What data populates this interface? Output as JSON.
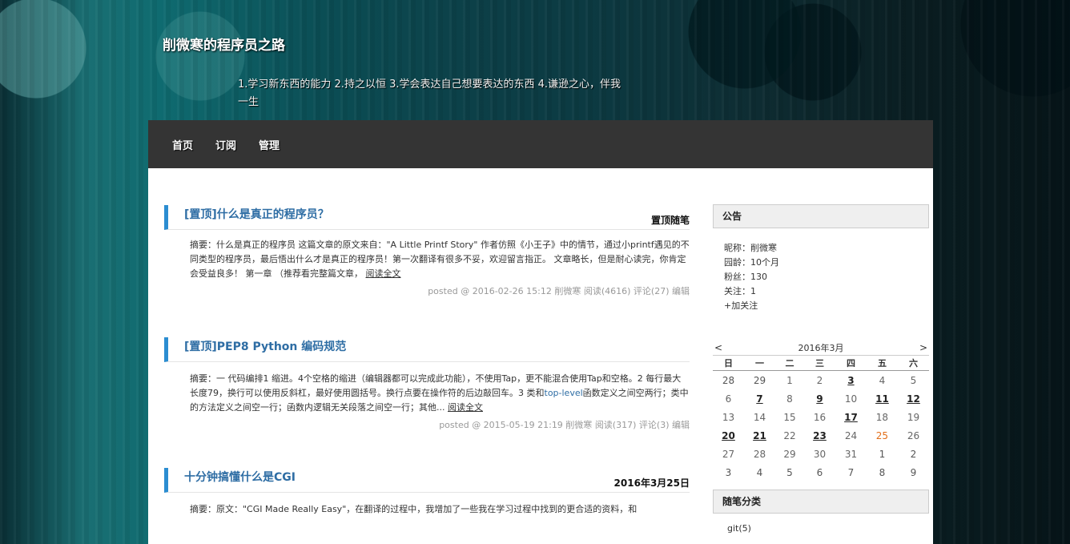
{
  "header": {
    "title": "削微寒的程序员之路",
    "description": "1.学习新东西的能力 2.持之以恒 3.学会表达自己想要表达的东西 4.谦逊之心，伴我一生"
  },
  "nav": {
    "items": [
      "首页",
      "订阅",
      "管理"
    ]
  },
  "posts": [
    {
      "title": "[置顶]什么是真正的程序员？",
      "date_label": "置顶随笔",
      "summary_a": "摘要：什么是真正的程序员 这篇文章的原文来自：\"A Little Printf Story\" 作者仿照《小王子》中的情节，通过小pri",
      "summary_b": "ntf遇见的不同类型的程序员，最后悟出什么才是真正的程序员！第一次翻译有很多不妥，欢迎留言指正。 文章略长，但是耐心读完，你肯定会受益良多！ 第一章 （推荐看完整篇文章， ",
      "read_more": "阅读全文",
      "footer_posted": "posted @ 2016-02-26 15:12 削微寒",
      "footer_reads": "阅读(4616)",
      "footer_comments": "评论(27)",
      "footer_edit": "编辑"
    },
    {
      "title": "[置顶]PEP8 Python 编码规范",
      "date_label": "",
      "summary_a": "摘要：一 代码编排1 缩进。4个空格的缩进（编辑器都可以完成此功能），不使用Tap，更不能混合使用Tap和空格。2 每行最大长度79，换行可以使用反斜杠，最好使用圆括号。换行点要在操作符的后边敲回车。3 类和",
      "summary_hl": "top-level",
      "summary_b": "函数定义之间空两行；类中的方法定义之间空一行；函数内逻辑无关段落之间空一行；其他... ",
      "read_more": "阅读全文",
      "footer_posted": "posted @ 2015-05-19 21:19 削微寒",
      "footer_reads": "阅读(317)",
      "footer_comments": "评论(3)",
      "footer_edit": "编辑"
    },
    {
      "title": "十分钟搞懂什么是CGI",
      "date_label": "2016年3月25日",
      "summary_a": "摘要：原文：\"CGI Made Really Easy\"，在翻译的过程中，我增加了一些我在学习过程中找到的更合适的资料，和"
    }
  ],
  "sidebar": {
    "notice_title": "公告",
    "nickname": "昵称：削微寒",
    "age": "园龄：10个月",
    "fans": "粉丝：130",
    "follows": "关注：1",
    "add_follow": "+加关注",
    "calendar": {
      "prev": "<",
      "next": ">",
      "month": "2016年3月",
      "weekdays": [
        "日",
        "一",
        "二",
        "三",
        "四",
        "五",
        "六"
      ],
      "weeks": [
        [
          "28",
          "29",
          "1",
          "2",
          "3",
          "4",
          "5"
        ],
        [
          "6",
          "7",
          "8",
          "9",
          "10",
          "11",
          "12"
        ],
        [
          "13",
          "14",
          "15",
          "16",
          "17",
          "18",
          "19"
        ],
        [
          "20",
          "21",
          "22",
          "23",
          "24",
          "25",
          "26"
        ],
        [
          "27",
          "28",
          "29",
          "30",
          "31",
          "1",
          "2"
        ],
        [
          "3",
          "4",
          "5",
          "6",
          "7",
          "8",
          "9"
        ]
      ],
      "linked_days": [
        "3",
        "7",
        "9",
        "11",
        "12",
        "17",
        "20",
        "21",
        "23"
      ],
      "today": "25"
    },
    "category_title": "随笔分类",
    "categories": [
      "git(5)"
    ]
  }
}
